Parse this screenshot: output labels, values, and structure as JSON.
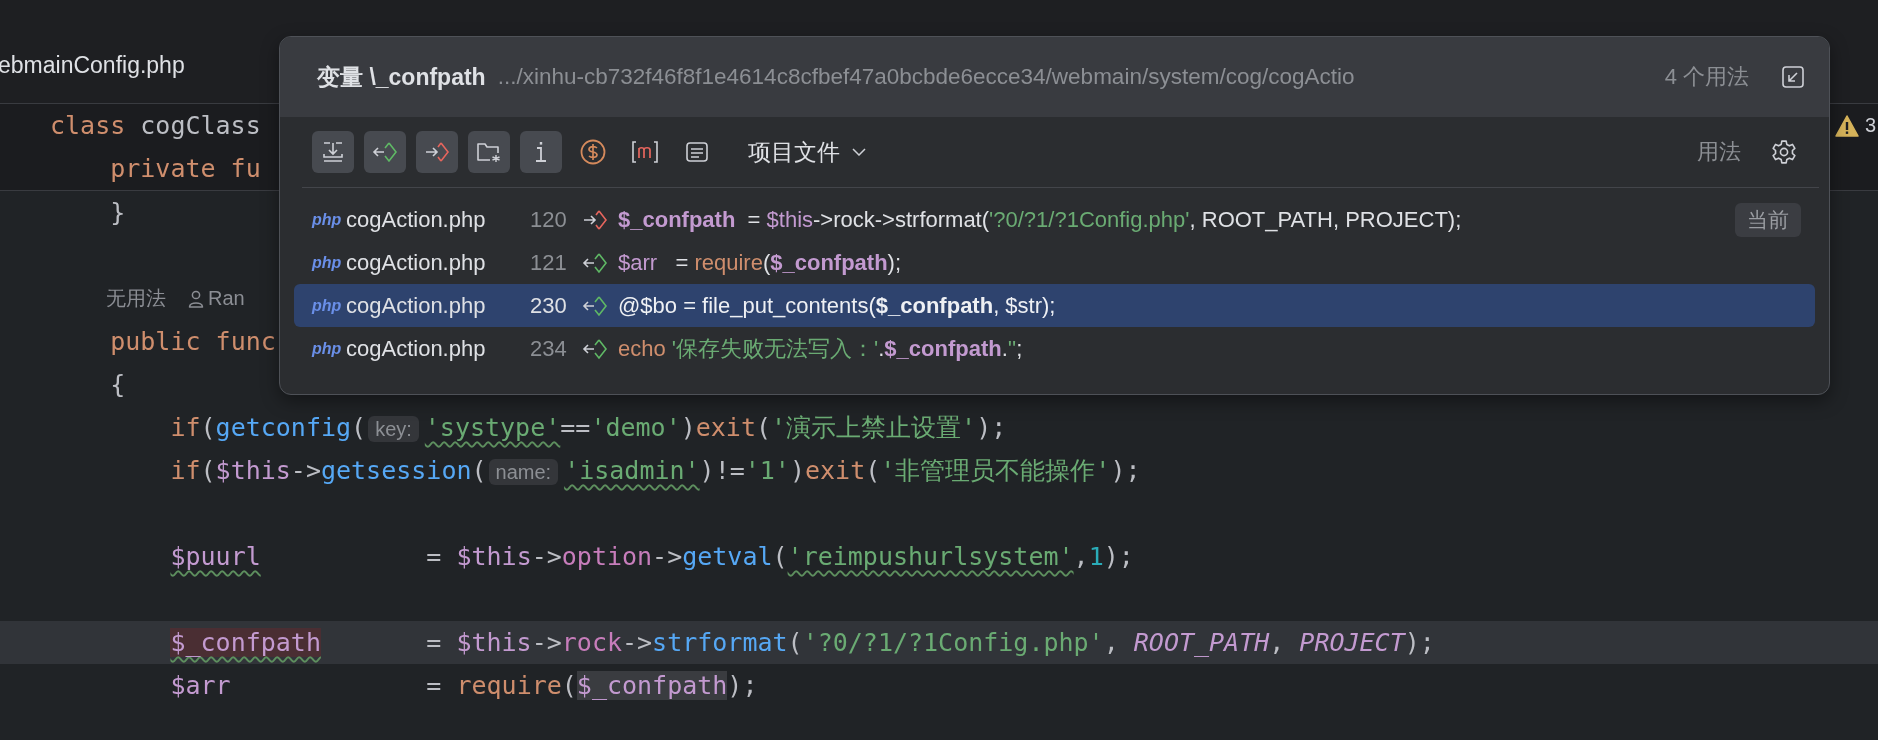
{
  "tab": {
    "label": "ebmainConfig.php"
  },
  "editor": {
    "sticky_lines": [
      {
        "tokens": [
          {
            "text": "class ",
            "kind": "keyword"
          },
          {
            "text": "cogClass",
            "kind": "plain"
          }
        ]
      },
      {
        "tokens": [
          {
            "text": "    private fu",
            "kind": "keyword"
          }
        ]
      }
    ],
    "problems": {
      "count": "3"
    },
    "lines": [
      {
        "kind": "code",
        "current": false,
        "tokens": [
          {
            "text": "    }",
            "kind": "plain"
          }
        ]
      },
      {
        "kind": "blank",
        "current": false
      },
      {
        "kind": "hint",
        "current": false,
        "usages": "无用法",
        "author": "Ran"
      },
      {
        "kind": "code",
        "current": false,
        "tokens": [
          {
            "text": "    public func",
            "kind": "keyword"
          }
        ]
      },
      {
        "kind": "code",
        "current": false,
        "tokens": [
          {
            "text": "    {",
            "kind": "plain"
          }
        ]
      },
      {
        "kind": "code",
        "current": false,
        "tokens": [
          {
            "text": "        if",
            "kind": "keyword"
          },
          {
            "text": "(",
            "kind": "plain"
          },
          {
            "text": "getconfig",
            "kind": "func"
          },
          {
            "text": "(",
            "kind": "plain"
          },
          {
            "text": "key:",
            "kind": "inlay"
          },
          {
            "text": "'systype'",
            "kind": "string",
            "squiggle": true
          },
          {
            "text": "==",
            "kind": "plain"
          },
          {
            "text": "'demo'",
            "kind": "string"
          },
          {
            "text": ")",
            "kind": "plain"
          },
          {
            "text": "exit",
            "kind": "keyword"
          },
          {
            "text": "(",
            "kind": "plain"
          },
          {
            "text": "'演示上禁止设置'",
            "kind": "string"
          },
          {
            "text": ");",
            "kind": "plain"
          }
        ]
      },
      {
        "kind": "code",
        "current": false,
        "tokens": [
          {
            "text": "        if",
            "kind": "keyword"
          },
          {
            "text": "(",
            "kind": "plain"
          },
          {
            "text": "$this",
            "kind": "var"
          },
          {
            "text": "->",
            "kind": "plain"
          },
          {
            "text": "getsession",
            "kind": "func"
          },
          {
            "text": "(",
            "kind": "plain"
          },
          {
            "text": "name:",
            "kind": "inlay"
          },
          {
            "text": "'isadmin'",
            "kind": "string",
            "squiggle": true
          },
          {
            "text": ")!=",
            "kind": "plain"
          },
          {
            "text": "'1'",
            "kind": "string"
          },
          {
            "text": ")",
            "kind": "plain"
          },
          {
            "text": "exit",
            "kind": "keyword"
          },
          {
            "text": "(",
            "kind": "plain"
          },
          {
            "text": "'非管理员不能操作'",
            "kind": "string"
          },
          {
            "text": ");",
            "kind": "plain"
          }
        ]
      },
      {
        "kind": "blank",
        "current": false
      },
      {
        "kind": "code",
        "current": false,
        "tokens": [
          {
            "text": "        $puurl",
            "kind": "var",
            "squiggle": true
          },
          {
            "text": "           = ",
            "kind": "plain"
          },
          {
            "text": "$this",
            "kind": "var"
          },
          {
            "text": "->",
            "kind": "plain"
          },
          {
            "text": "option",
            "kind": "field"
          },
          {
            "text": "->",
            "kind": "plain"
          },
          {
            "text": "getval",
            "kind": "func"
          },
          {
            "text": "(",
            "kind": "plain"
          },
          {
            "text": "'reimpushurlsystem'",
            "kind": "string",
            "squiggle": true
          },
          {
            "text": ",",
            "kind": "plain"
          },
          {
            "text": "1",
            "kind": "number"
          },
          {
            "text": ");",
            "kind": "plain"
          }
        ]
      },
      {
        "kind": "blank",
        "current": false
      },
      {
        "kind": "code",
        "current": true,
        "tokens": [
          {
            "text": "        $_confpath",
            "kind": "var",
            "squiggle": true,
            "write_highlight": true
          },
          {
            "text": "       = ",
            "kind": "plain"
          },
          {
            "text": "$this",
            "kind": "var"
          },
          {
            "text": "->",
            "kind": "plain"
          },
          {
            "text": "rock",
            "kind": "field"
          },
          {
            "text": "->",
            "kind": "plain"
          },
          {
            "text": "strformat",
            "kind": "func"
          },
          {
            "text": "(",
            "kind": "plain"
          },
          {
            "text": "'?0/?1/?1Config.php'",
            "kind": "string"
          },
          {
            "text": ", ",
            "kind": "plain"
          },
          {
            "text": "ROOT_PATH",
            "kind": "const"
          },
          {
            "text": ", ",
            "kind": "plain"
          },
          {
            "text": "PROJECT",
            "kind": "const"
          },
          {
            "text": ");",
            "kind": "plain"
          }
        ]
      },
      {
        "kind": "code",
        "current": false,
        "tokens": [
          {
            "text": "        $arr",
            "kind": "var"
          },
          {
            "text": "             = ",
            "kind": "plain"
          },
          {
            "text": "require",
            "kind": "keyword"
          },
          {
            "text": "(",
            "kind": "plain"
          },
          {
            "text": "$_confpath",
            "kind": "var",
            "read_highlight": true
          },
          {
            "text": ");",
            "kind": "plain"
          }
        ]
      }
    ]
  },
  "popup": {
    "title": "变量 \\_confpath",
    "path": ".../xinhu-cb732f46f8f1e4614c8cfbef47a0bcbde6ecce34/webmain/system/cog/cogActio",
    "usage_count": "4 个用法",
    "toolbar": [
      {
        "kind": "group",
        "selected": true
      },
      {
        "kind": "read",
        "selected": true
      },
      {
        "kind": "write",
        "selected": true
      },
      {
        "kind": "folder",
        "selected": true
      },
      {
        "kind": "info",
        "selected": true
      },
      {
        "kind": "dollar",
        "selected": false
      },
      {
        "kind": "method",
        "selected": false
      },
      {
        "kind": "list",
        "selected": false
      }
    ],
    "scope": "项目文件",
    "mode_label": "用法",
    "usages": [
      {
        "file_type": "php",
        "file": "cogAction.php",
        "line": "120",
        "write": true,
        "selected": false,
        "badge": "当前",
        "tokens": [
          {
            "text": "$_confpath",
            "kind": "match"
          },
          {
            "text": "  = ",
            "kind": "plain"
          },
          {
            "text": "$this",
            "kind": "var"
          },
          {
            "text": "->rock->strformat(",
            "kind": "plain"
          },
          {
            "text": "'?0/?1/?1Config.php'",
            "kind": "string"
          },
          {
            "text": ", ROOT_PATH, PROJECT);",
            "kind": "plain"
          }
        ]
      },
      {
        "file_type": "php",
        "file": "cogAction.php",
        "line": "121",
        "write": false,
        "selected": false,
        "tokens": [
          {
            "text": "$arr",
            "kind": "var"
          },
          {
            "text": "   = ",
            "kind": "plain"
          },
          {
            "text": "require",
            "kind": "keyword"
          },
          {
            "text": "(",
            "kind": "plain"
          },
          {
            "text": "$_confpath",
            "kind": "match"
          },
          {
            "text": ");",
            "kind": "plain"
          }
        ]
      },
      {
        "file_type": "php",
        "file": "cogAction.php",
        "line": "230",
        "write": false,
        "selected": true,
        "tokens": [
          {
            "text": "@$bo = file_put_contents(",
            "kind": "plain"
          },
          {
            "text": "$_confpath",
            "kind": "match"
          },
          {
            "text": ", $str);",
            "kind": "plain"
          }
        ]
      },
      {
        "file_type": "php",
        "file": "cogAction.php",
        "line": "234",
        "write": false,
        "selected": false,
        "tokens": [
          {
            "text": "echo ",
            "kind": "keyword"
          },
          {
            "text": "'保存失败无法写入：'",
            "kind": "string"
          },
          {
            "text": ".",
            "kind": "plain"
          },
          {
            "text": "$_confpath",
            "kind": "match"
          },
          {
            "text": ".",
            "kind": "plain"
          },
          {
            "text": "''",
            "kind": "string"
          },
          {
            "text": ";",
            "kind": "plain"
          }
        ]
      }
    ]
  }
}
